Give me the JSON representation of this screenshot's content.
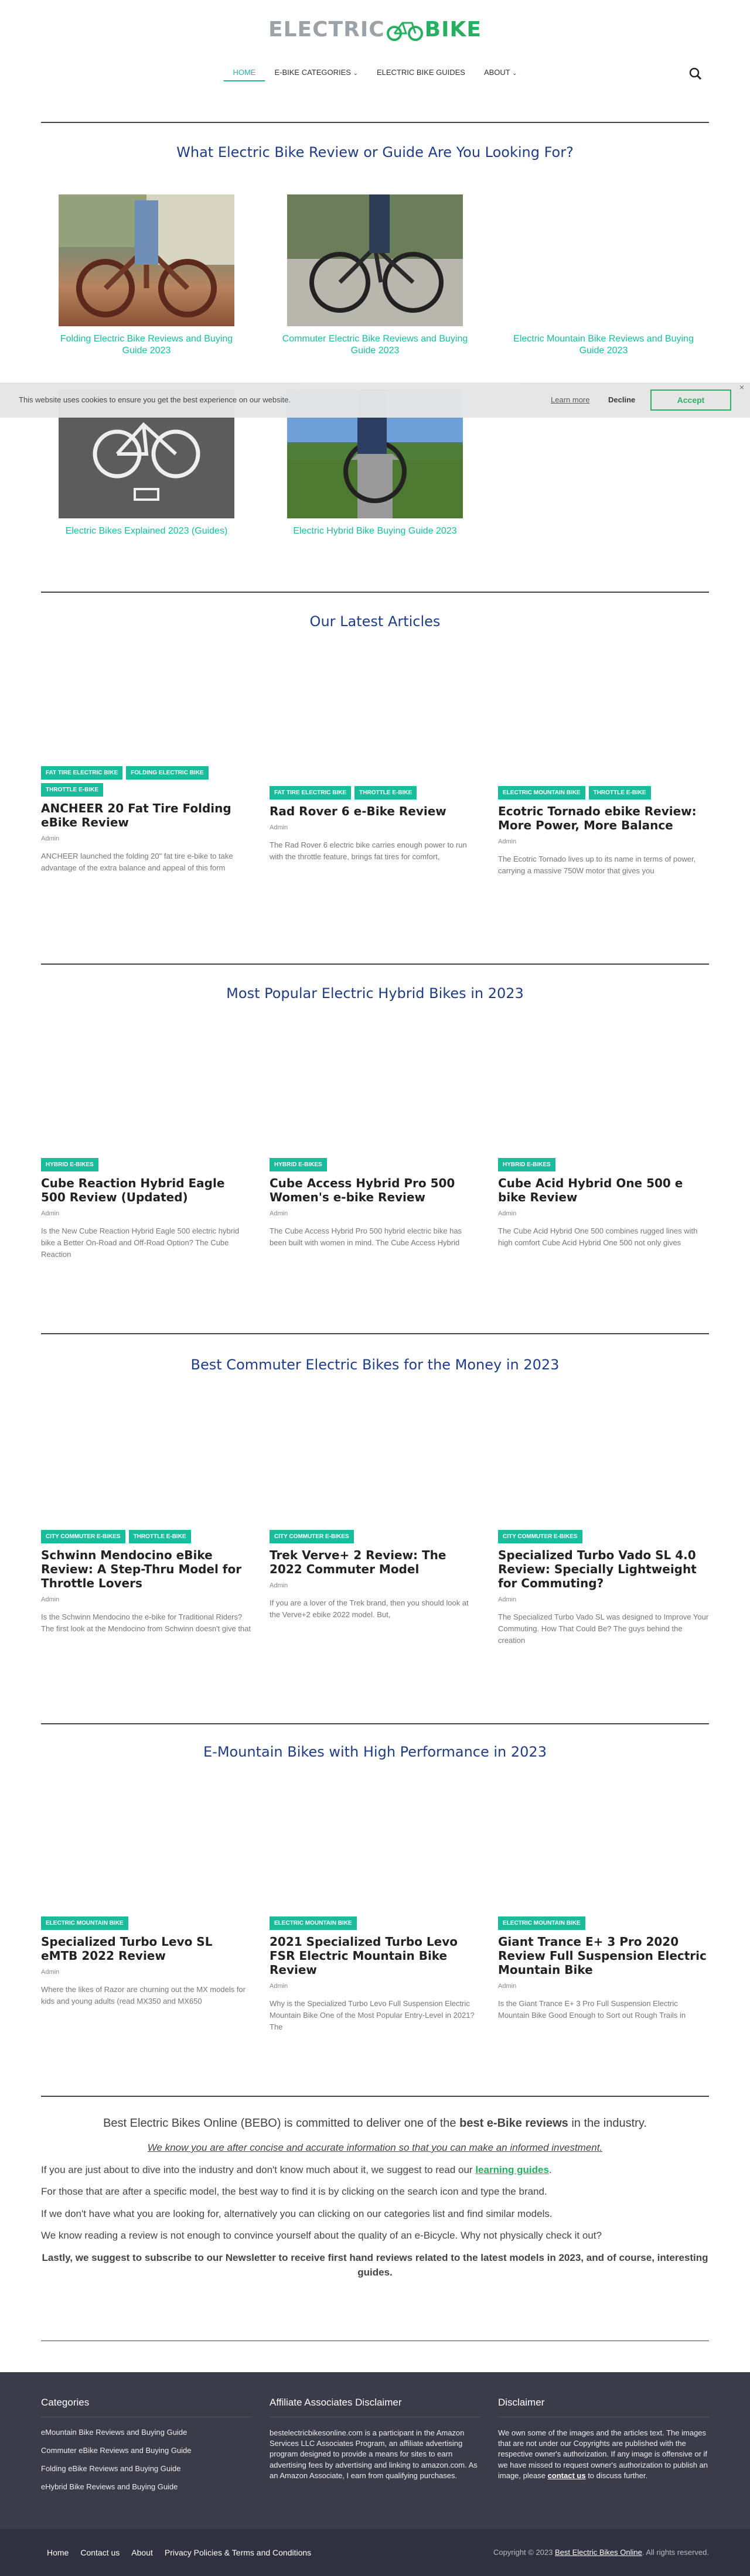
{
  "header": {
    "logo_left": "ELECTRIC",
    "logo_right": "BIKE",
    "nav": [
      {
        "label": "HOME",
        "active": true,
        "caret": false
      },
      {
        "label": "E-BIKE CATEGORIES",
        "active": false,
        "caret": true
      },
      {
        "label": "ELECTRIC BIKE GUIDES",
        "active": false,
        "caret": false
      },
      {
        "label": "ABOUT",
        "active": false,
        "caret": true
      }
    ],
    "caret_glyph": "⌄"
  },
  "guides_section": {
    "title": "What Electric Bike Review or Guide Are You Looking For?",
    "items": [
      {
        "label": "Folding Electric Bike Reviews and Buying Guide 2023"
      },
      {
        "label": "Commuter Electric Bike Reviews and Buying Guide 2023"
      },
      {
        "label": "Electric Mountain Bike Reviews and Buying Guide 2023"
      },
      {
        "label": "Electric Bikes Explained 2023 (Guides)"
      },
      {
        "label": "Electric Hybrid Bike Buying Guide 2023"
      }
    ]
  },
  "cookie": {
    "message": "This website uses cookies to ensure you get the best experience on our website.",
    "learn_more": "Learn more",
    "decline": "Decline",
    "accept": "Accept",
    "close": "×"
  },
  "latest": {
    "title": "Our Latest Articles",
    "cards": [
      {
        "tags": [
          "FAT TIRE ELECTRIC BIKE",
          "FOLDING ELECTRIC BIKE",
          "THROTTLE E-BIKE"
        ],
        "title": "ANCHEER 20 Fat Tire Folding eBike Review",
        "author": "Admin",
        "excerpt": "ANCHEER launched the folding 20\" fat tire e-bike to take advantage of the extra balance and appeal of this form"
      },
      {
        "tags": [
          "FAT TIRE ELECTRIC BIKE",
          "THROTTLE E-BIKE"
        ],
        "title": "Rad Rover 6 e-Bike Review",
        "author": "Admin",
        "excerpt": "The Rad Rover 6 electric bike carries enough power to run with the throttle feature, brings fat tires for comfort,"
      },
      {
        "tags": [
          "ELECTRIC MOUNTAIN BIKE",
          "THROTTLE E-BIKE"
        ],
        "title": "Ecotric Tornado ebike Review: More Power, More Balance",
        "author": "Admin",
        "excerpt": "The Ecotric Tornado lives up to its name in terms of power, carrying a massive 750W motor that gives you"
      }
    ]
  },
  "hybrid": {
    "title": "Most Popular Electric Hybrid Bikes in 2023",
    "cards": [
      {
        "tags": [
          "HYBRID E-BIKES"
        ],
        "title": "Cube Reaction Hybrid Eagle 500 Review (Updated)",
        "author": "Admin",
        "excerpt": "Is the New Cube Reaction Hybrid Eagle 500 electric hybrid bike a Better On-Road and Off-Road Option? The Cube Reaction"
      },
      {
        "tags": [
          "HYBRID E-BIKES"
        ],
        "title": "Cube Access Hybrid Pro 500 Women's e-bike Review",
        "author": "Admin",
        "excerpt": " The Cube Access Hybrid Pro 500 hybrid electric bike has been built with women in mind. The Cube Access Hybrid"
      },
      {
        "tags": [
          "HYBRID E-BIKES"
        ],
        "title": "Cube Acid Hybrid One 500 e bike Review",
        "author": "Admin",
        "excerpt": "The Cube Acid Hybrid One 500 combines rugged lines with high comfort Cube Acid Hybrid One 500 not only gives"
      }
    ]
  },
  "commuter": {
    "title": "Best Commuter Electric Bikes for the Money in 2023",
    "cards": [
      {
        "tags": [
          "CITY COMMUTER E-BIKES",
          "THROTTLE E-BIKE"
        ],
        "title": "Schwinn Mendocino eBike Review: A Step-Thru Model for Throttle Lovers",
        "author": "Admin",
        "excerpt": "Is the Schwinn Mendocino the e-bike for Traditional Riders? The first look at the Mendocino from Schwinn doesn't give that"
      },
      {
        "tags": [
          "CITY COMMUTER E-BIKES"
        ],
        "title": "Trek Verve+ 2 Review: The 2022 Commuter Model",
        "author": "Admin",
        "excerpt": "If you are a lover of the Trek brand, then you should look at the Verve+2 ebike 2022 model. But,"
      },
      {
        "tags": [
          "CITY COMMUTER E-BIKES"
        ],
        "title": "Specialized Turbo Vado SL 4.0 Review: Specially Lightweight for Commuting?",
        "author": "Admin",
        "excerpt": "The Specialized Turbo Vado SL was designed to Improve Your Commuting. How That Could Be? The guys behind the creation"
      }
    ]
  },
  "emtb": {
    "title": "E-Mountain Bikes with High Performance in 2023",
    "cards": [
      {
        "tags": [
          "ELECTRIC MOUNTAIN BIKE"
        ],
        "title": "Specialized Turbo Levo SL eMTB 2022 Review",
        "author": "Admin",
        "excerpt": "Where the likes of Razor are churning out the MX models for kids and young adults (read MX350 and MX650"
      },
      {
        "tags": [
          "ELECTRIC MOUNTAIN BIKE"
        ],
        "title": "2021 Specialized Turbo Levo FSR Electric Mountain Bike Review",
        "author": "Admin",
        "excerpt": "Why is the Specialized Turbo Levo Full Suspension Electric Mountain Bike One of the Most Popular Entry-Level in 2021? The"
      },
      {
        "tags": [
          "ELECTRIC MOUNTAIN BIKE"
        ],
        "title": "Giant Trance E+ 3 Pro 2020 Review Full Suspension Electric Mountain Bike",
        "author": "Admin",
        "excerpt": "Is the Giant Trance E+ 3 Pro Full Suspension Electric Mountain Bike Good Enough to Sort out Rough Trails in"
      }
    ]
  },
  "about": {
    "intro_a": "Best Electric Bikes Online (BEBO) is committed to deliver one of the ",
    "intro_b": "best e-Bike reviews",
    "intro_c": " in the industry.",
    "em": "We know you are after concise and accurate information so that you can make an informed investment.",
    "p1_a": "If you are just about to dive into the industry and don't know much about it, we suggest to read our ",
    "p1_link": "learning guides",
    "p1_c": ".",
    "p2": "For those that are after a specific model, the best way to find it is by clicking on the search icon and type the brand.",
    "p3": "If we don't have what you are looking for, alternatively you can clicking on our categories list and find similar models.",
    "p4": "We know reading a review is not enough to convince yourself about the quality of an e-Bicycle. Why not physically check it out?",
    "p5": "Lastly, we suggest to subscribe to our Newsletter to receive first hand reviews related to the latest models in 2023, and of course, interesting guides."
  },
  "footer": {
    "categories_title": "Categories",
    "categories": [
      "eMountain Bike Reviews and Buying Guide",
      "Commuter eBike Reviews and Buying Guide",
      "Folding eBike Reviews and Buying Guide",
      "eHybrid Bike Reviews and Buying Guide"
    ],
    "affiliate_title": "Affiliate Associates Disclaimer",
    "affiliate_text": "bestelectricbikesonline.com is a participant in the Amazon Services LLC Associates Program, an affiliate advertising program designed to provide a means for sites to earn advertising fees by advertising and linking to amazon.com. As an Amazon Associate, I earn from qualifying purchases.",
    "disclaimer_title": "Disclaimer",
    "disclaimer_text_a": "We own some of the images and the articles text. The images that are not under our Copyrights are published with the respective owner's authorization. If any image is offensive or if we have missed to request owner's authorization to publish an image, please ",
    "disclaimer_link": "contact us",
    "disclaimer_text_c": " to discuss further.",
    "bottom_links": [
      "Home",
      "Contact us",
      "About",
      "Privacy Policies & Terms and Conditions"
    ],
    "copyright_a": "Copyright © 2023 ",
    "copyright_link": "Best Electric Bikes Online",
    "copyright_c": ". All rights reserved."
  }
}
